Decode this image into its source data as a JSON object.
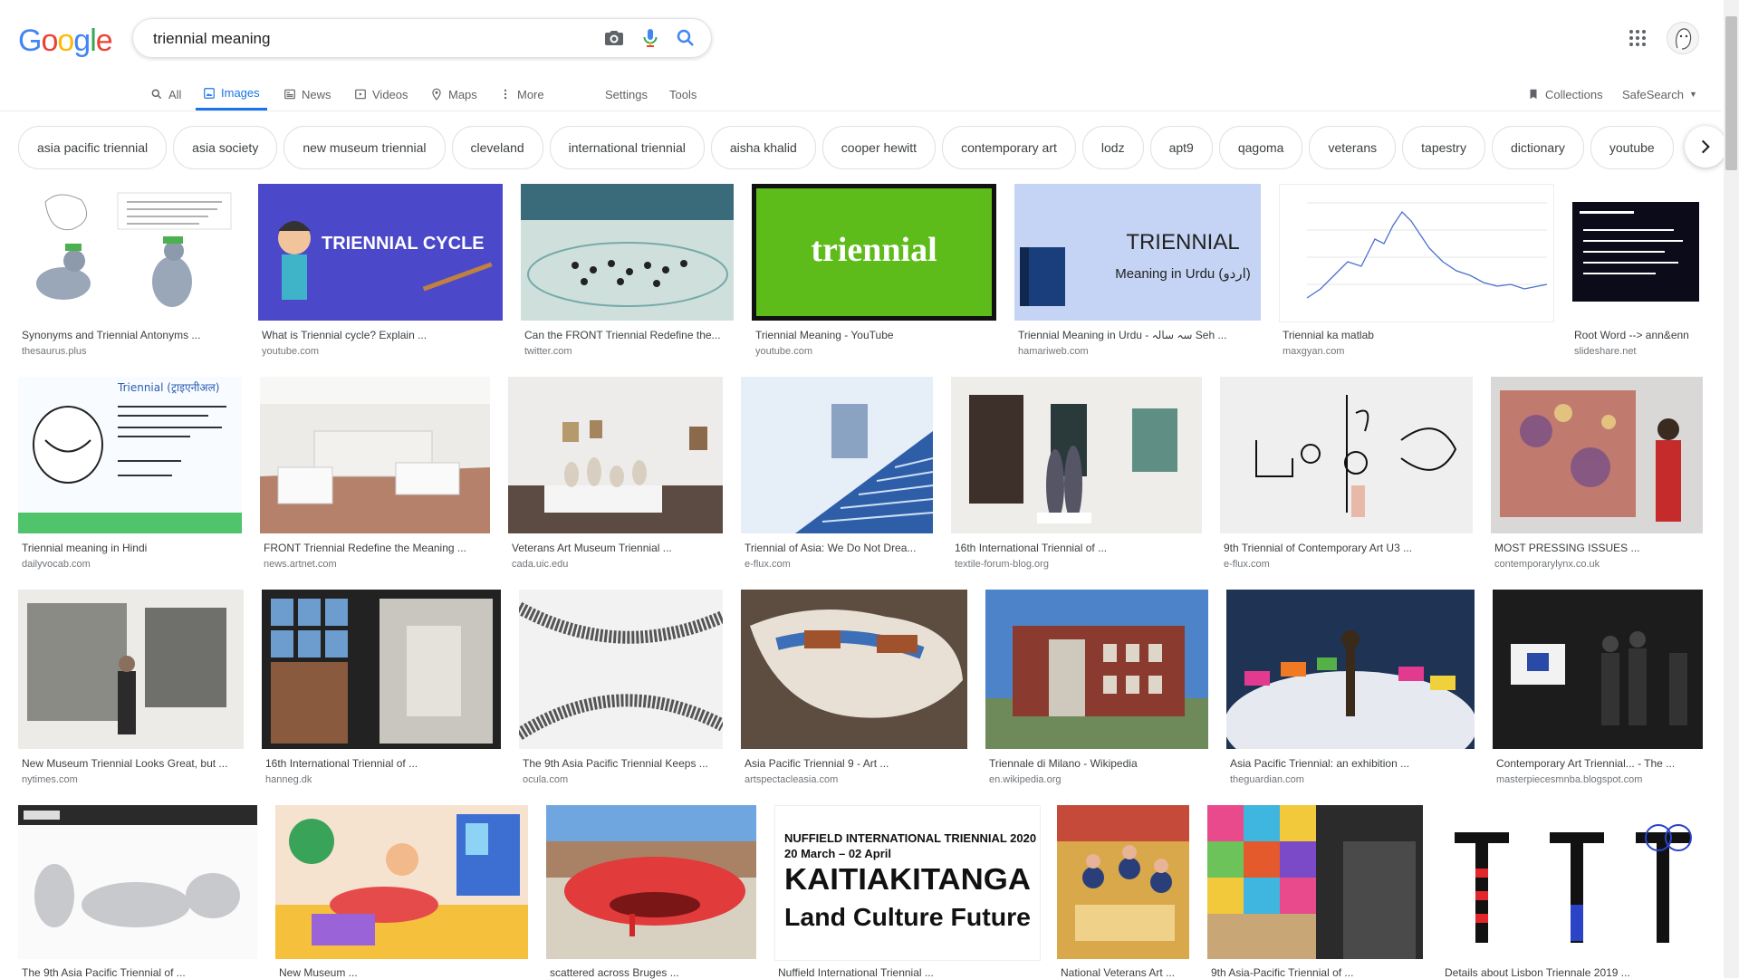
{
  "logo": "Google",
  "search": {
    "value": "triennial meaning"
  },
  "tabs": [
    {
      "label": "All"
    },
    {
      "label": "Images"
    },
    {
      "label": "News"
    },
    {
      "label": "Videos"
    },
    {
      "label": "Maps"
    },
    {
      "label": "More"
    },
    {
      "label": "Settings"
    },
    {
      "label": "Tools"
    }
  ],
  "collections": "Collections",
  "safesearch": "SafeSearch",
  "chips": [
    "asia pacific triennial",
    "asia society",
    "new museum triennial",
    "cleveland",
    "international triennial",
    "aisha khalid",
    "cooper hewitt",
    "contemporary art",
    "lodz",
    "apt9",
    "qagoma",
    "veterans",
    "tapestry",
    "dictionary",
    "youtube"
  ],
  "thumb_text": {
    "triennial_cycle": "TRIENNIAL CYCLE",
    "triennial": "triennial",
    "urdu_title": "TRIENNIAL",
    "urdu_sub": "Meaning in Urdu (اردو)",
    "nuffield_line1": "NUFFIELD INTERNATIONAL TRIENNIAL 2020",
    "nuffield_line2": "20 March – 02 April",
    "nuffield_big": "KAITIAKITANGA",
    "nuffield_sub": "Land Culture Future",
    "hindi_title": "Triennial (ट्राइएनीअल)"
  },
  "results": [
    {
      "title": "Synonyms and Triennial Antonyms ...",
      "source": "thesaurus.plus"
    },
    {
      "title": "What is Triennial cycle? Explain ...",
      "source": "youtube.com"
    },
    {
      "title": "Can the FRONT Triennial Redefine the...",
      "source": "twitter.com"
    },
    {
      "title": "Triennial Meaning - YouTube",
      "source": "youtube.com"
    },
    {
      "title": "Triennial Meaning in Urdu - سہ سالہ Seh ...",
      "source": "hamariweb.com"
    },
    {
      "title": "Triennial ka matlab",
      "source": "maxgyan.com"
    },
    {
      "title": "Root Word --> ann&enn",
      "source": "slideshare.net"
    },
    {
      "title": "Triennial meaning in Hindi",
      "source": "dailyvocab.com"
    },
    {
      "title": "FRONT Triennial Redefine the Meaning ...",
      "source": "news.artnet.com"
    },
    {
      "title": "Veterans Art Museum Triennial ...",
      "source": "cada.uic.edu"
    },
    {
      "title": "Triennial of Asia: We Do Not Drea...",
      "source": "e-flux.com"
    },
    {
      "title": "16th International Triennial of ...",
      "source": "textile-forum-blog.org"
    },
    {
      "title": "9th Triennial of Contemporary Art U3 ...",
      "source": "e-flux.com"
    },
    {
      "title": "MOST PRESSING ISSUES ...",
      "source": "contemporarylynx.co.uk"
    },
    {
      "title": "New Museum Triennial Looks Great, but ...",
      "source": "nytimes.com"
    },
    {
      "title": "16th International Triennial of ...",
      "source": "hanneg.dk"
    },
    {
      "title": "The 9th Asia Pacific Triennial Keeps ...",
      "source": "ocula.com"
    },
    {
      "title": "Asia Pacific Triennial 9 - Art ...",
      "source": "artspectacleasia.com"
    },
    {
      "title": "Triennale di Milano - Wikipedia",
      "source": "en.wikipedia.org"
    },
    {
      "title": "Asia Pacific Triennial: an exhibition ...",
      "source": "theguardian.com"
    },
    {
      "title": "Contemporary Art Triennial... - The ...",
      "source": "masterpiecesmnba.blogspot.com"
    },
    {
      "title": "The 9th Asia Pacific Triennial of ...",
      "source": ""
    },
    {
      "title": "New Museum ...",
      "source": ""
    },
    {
      "title": "scattered across Bruges ...",
      "source": ""
    },
    {
      "title": "Nuffield International Triennial ...",
      "source": ""
    },
    {
      "title": "National Veterans Art ...",
      "source": ""
    },
    {
      "title": "9th Asia-Pacific Triennial of ...",
      "source": ""
    },
    {
      "title": "Details about Lisbon Triennale 2019 ...",
      "source": ""
    }
  ]
}
